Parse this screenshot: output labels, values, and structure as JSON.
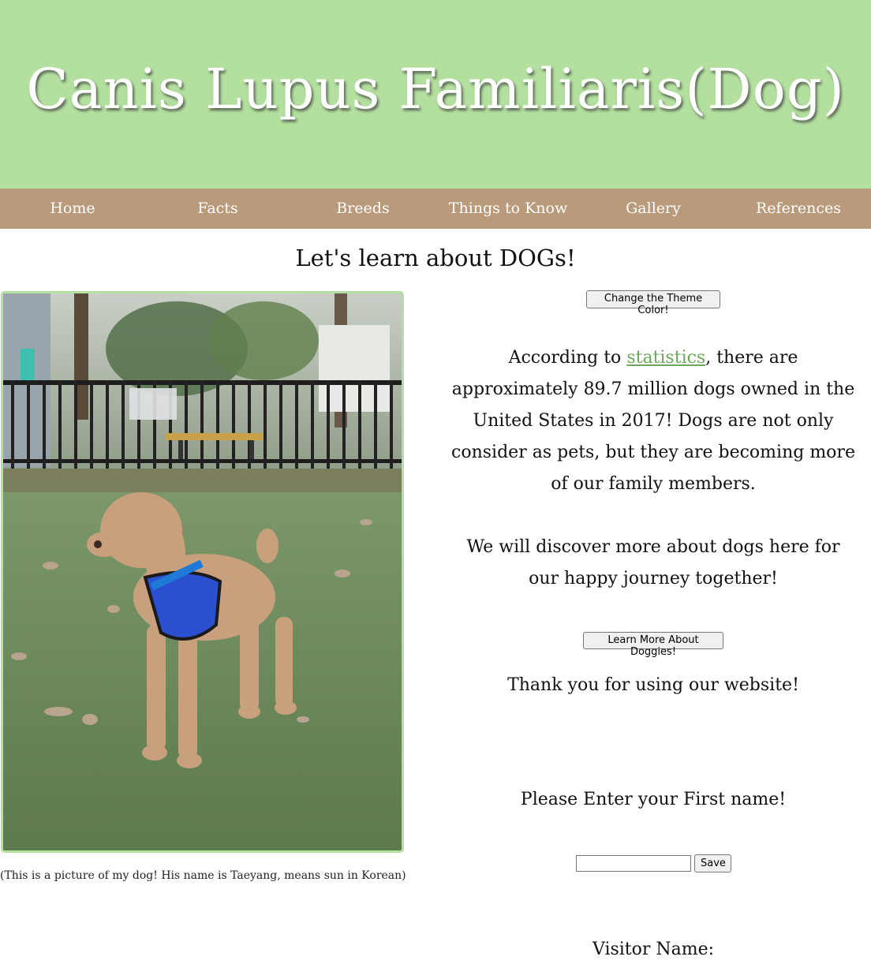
{
  "header": {
    "title": "Canis Lupus Familiaris(Dog)"
  },
  "nav": {
    "items": [
      "Home",
      "Facts",
      "Breeds",
      "Things to Know",
      "Gallery",
      "References"
    ]
  },
  "main": {
    "heading": "Let's learn about DOGs!",
    "photo_caption": "(This is a picture of my dog! His name is Taeyang, means sun in Korean)",
    "theme_button": "Change the Theme Color!",
    "para1_before": "According to ",
    "para1_link": "statistics",
    "para1_after": ", there are approximately 89.7 million dogs owned in the United States in 2017! Dogs are not only consider as pets, but they are becoming more of our family members.",
    "para2": "We will discover more about dogs here for our happy journey together!",
    "learn_button": "Learn More About Doggies!",
    "thanks": "Thank you for using our website!",
    "name_prompt": "Please Enter your First name!",
    "name_input": {
      "value": "",
      "placeholder": ""
    },
    "save_button": "Save",
    "visitor_label": "Visitor Name:"
  },
  "colors": {
    "header_bg": "#b3df9f",
    "nav_bg": "#b99a7a",
    "link": "#6aa85a"
  }
}
